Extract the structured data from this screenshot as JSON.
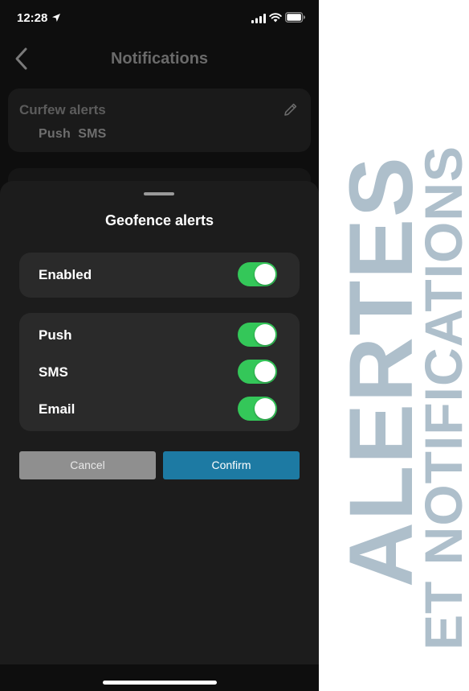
{
  "status_bar": {
    "time": "12:28"
  },
  "nav": {
    "title": "Notifications"
  },
  "background_card": {
    "title": "Curfew alerts",
    "channels": "Push  SMS"
  },
  "sheet": {
    "title": "Geofence alerts",
    "enabled": {
      "label": "Enabled",
      "on": true
    },
    "channels": [
      {
        "label": "Push",
        "on": true
      },
      {
        "label": "SMS",
        "on": true
      },
      {
        "label": "Email",
        "on": true
      }
    ],
    "cancel_label": "Cancel",
    "confirm_label": "Confirm"
  },
  "banner": {
    "line1": "ALERTES",
    "line2": "ET NOTIFICATIONS"
  },
  "colors": {
    "toggle_on": "#34c759",
    "confirm": "#1d7aa3",
    "cancel": "#8f8f8f",
    "banner_text": "#aebfcb"
  },
  "icons": [
    "location-arrow-icon",
    "signal-icon",
    "wifi-icon",
    "battery-icon",
    "chevron-left-icon",
    "pencil-icon"
  ]
}
